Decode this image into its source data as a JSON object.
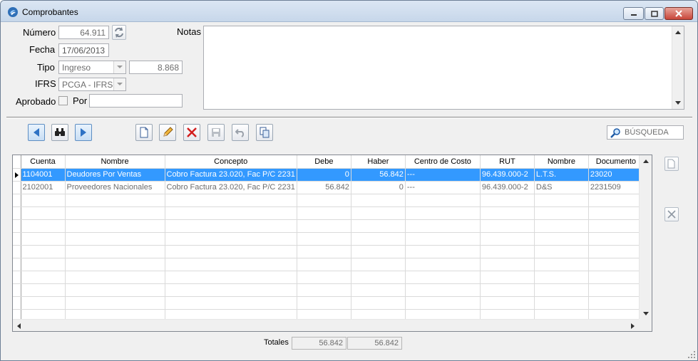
{
  "window": {
    "title": "Comprobantes"
  },
  "form": {
    "numero_label": "Número",
    "numero_value": "64.911",
    "fecha_label": "Fecha",
    "fecha_value": "17/06/2013",
    "tipo_label": "Tipo",
    "tipo_value": "Ingreso",
    "tipo_number": "8.868",
    "ifrs_label": "IFRS",
    "ifrs_value": "PCGA - IFRS",
    "aprobado_label": "Aprobado",
    "por_label": "Por",
    "por_value": "",
    "notas_label": "Notas",
    "notas_value": ""
  },
  "toolbar": {
    "search_placeholder": "BÚSQUEDA"
  },
  "grid": {
    "columns": [
      "Cuenta",
      "Nombre",
      "Concepto",
      "Debe",
      "Haber",
      "Centro de Costo",
      "RUT",
      "Nombre",
      "Documento"
    ],
    "rows": [
      [
        "1104001",
        "Deudores Por Ventas",
        "Cobro Factura 23.020, Fac P/C 2231",
        "0",
        "56.842",
        "---",
        "96.439.000-2",
        "L.T.S.",
        "23020"
      ],
      [
        "2102001",
        "Proveedores Nacionales",
        "Cobro Factura 23.020, Fac P/C 2231",
        "56.842",
        "0",
        "---",
        "96.439.000-2",
        "D&S",
        "2231509"
      ]
    ],
    "empty_rows": 10,
    "selected_row": 0
  },
  "totals": {
    "label": "Totales",
    "debe": "56.842",
    "haber": "56.842"
  },
  "colors": {
    "selection": "#3399ff",
    "title_bar": "#c7d7ea"
  }
}
